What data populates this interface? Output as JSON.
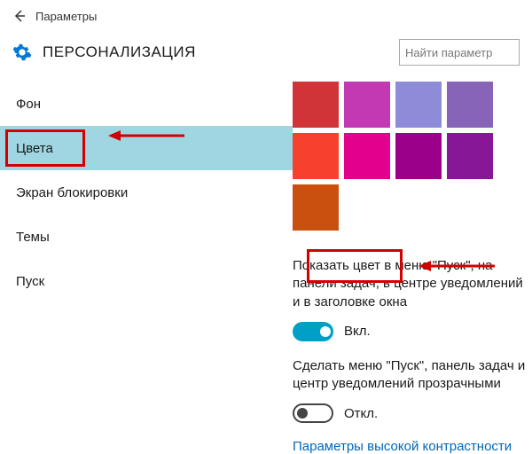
{
  "titlebar": {
    "label": "Параметры"
  },
  "header": {
    "title": "ПЕРСОНАЛИЗАЦИЯ",
    "search_placeholder": "Найти параметр"
  },
  "sidebar": {
    "items": [
      {
        "label": "Фон"
      },
      {
        "label": "Цвета"
      },
      {
        "label": "Экран блокировки"
      },
      {
        "label": "Темы"
      },
      {
        "label": "Пуск"
      }
    ],
    "selected_index": 1
  },
  "swatches": {
    "row1": [
      "#d13438",
      "#c239b3",
      "#8e8cd8",
      "#8764b8"
    ],
    "row2": [
      "#f7412d",
      "#e3008c",
      "#9a0089",
      "#881798"
    ],
    "row3": [
      "#ca5010"
    ]
  },
  "setting1": {
    "text": "Показать цвет в меню \"Пуск\", на панели задач, в центре уведомлений и в заголовке окна",
    "state_label": "Вкл.",
    "on": true
  },
  "setting2": {
    "text": "Сделать меню \"Пуск\", панель задач и центр уведомлений прозрачными",
    "state_label": "Откл.",
    "on": false
  },
  "link": {
    "label": "Параметры высокой контрастности"
  }
}
